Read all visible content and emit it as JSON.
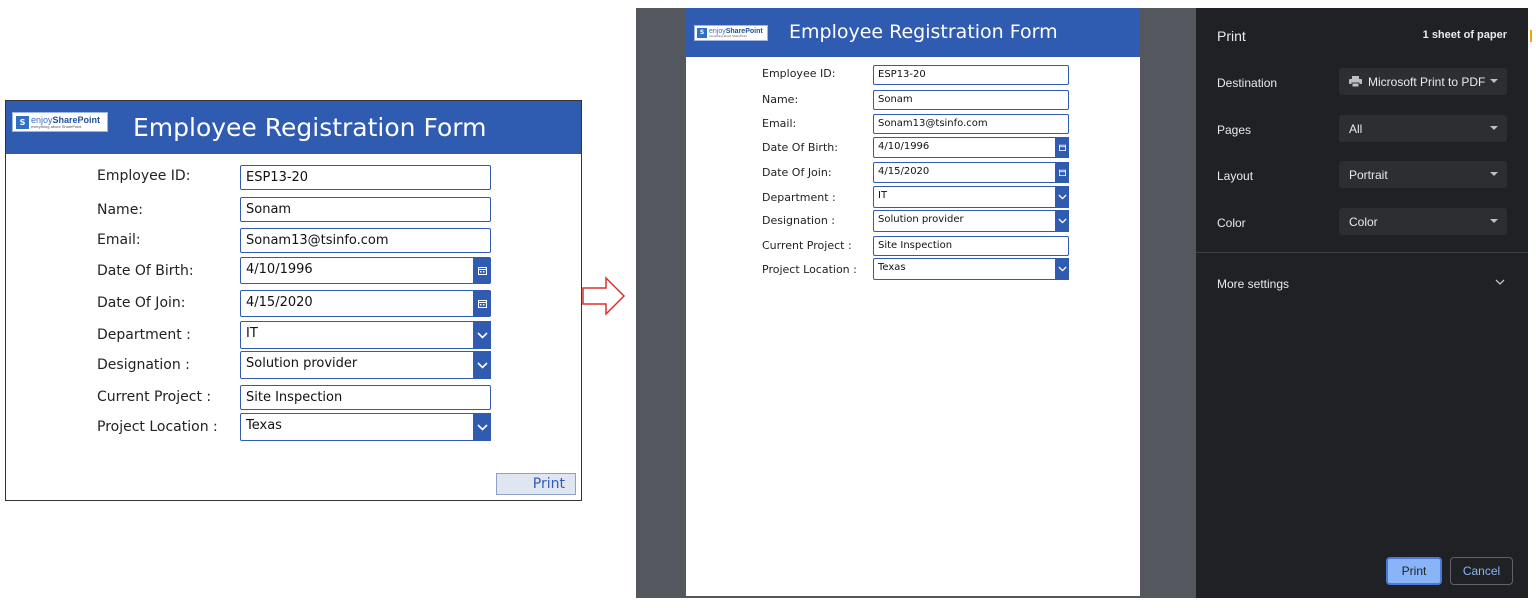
{
  "form": {
    "logo": {
      "brand_light": "enjoy",
      "brand_bold": "SharePoint",
      "tagline": "everything about SharePoint"
    },
    "title": "Employee Registration Form",
    "fields": {
      "employee_id": {
        "label": "Employee ID:",
        "value": "ESP13-20"
      },
      "name": {
        "label": "Name:",
        "value": "Sonam"
      },
      "email": {
        "label": "Email:",
        "value": "Sonam13@tsinfo.com"
      },
      "dob": {
        "label": "Date Of Birth:",
        "value": "4/10/1996"
      },
      "doj": {
        "label": "Date Of Join:",
        "value": "4/15/2020"
      },
      "department": {
        "label": "Department :",
        "value": "IT"
      },
      "designation": {
        "label": "Designation :",
        "value": "Solution provider"
      },
      "current_project": {
        "label": "Current Project :",
        "value": "Site Inspection"
      },
      "project_location": {
        "label": "Project Location :",
        "value": "Texas"
      }
    },
    "print_button": "Print"
  },
  "dialog": {
    "title": "Print",
    "sheets": "1 sheet of paper",
    "destination": {
      "label": "Destination",
      "value": "Microsoft Print to PDF"
    },
    "pages": {
      "label": "Pages",
      "value": "All"
    },
    "layout": {
      "label": "Layout",
      "value": "Portrait"
    },
    "color": {
      "label": "Color",
      "value": "Color"
    },
    "more_settings": "More settings",
    "print_button": "Print",
    "cancel_button": "Cancel"
  },
  "colors": {
    "form_header": "#2f5bb1",
    "dialog_bg": "#202124",
    "accent": "#8ab4f8",
    "arrow": "#d9302c"
  }
}
